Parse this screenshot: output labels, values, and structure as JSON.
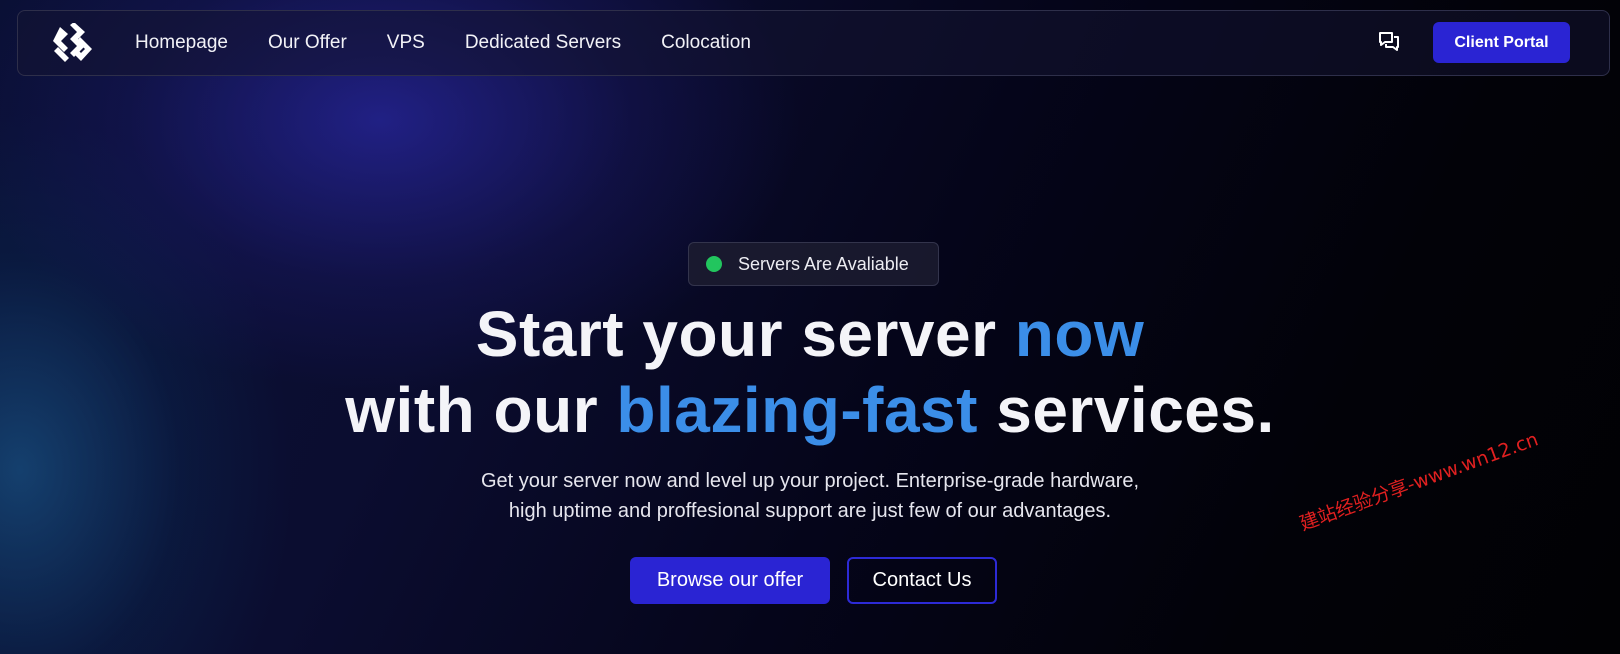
{
  "nav": {
    "logo_icon": "brand-logo-icon",
    "links": [
      {
        "label": "Homepage"
      },
      {
        "label": "Our Offer"
      },
      {
        "label": "VPS"
      },
      {
        "label": "Dedicated Servers"
      },
      {
        "label": "Colocation"
      }
    ],
    "chat_icon": "chat-bubbles-icon",
    "client_portal_label": "Client Portal"
  },
  "hero": {
    "status_text": "Servers Are Avaliable",
    "status_color": "#22c55e",
    "title_line1_a": "Start your server ",
    "title_line1_accent": "now",
    "title_line2_a": "with our ",
    "title_line2_accent": "blazing-fast",
    "title_line2_b": " services.",
    "subtitle_line1": "Get your server now and level up your project. Enterprise-grade hardware,",
    "subtitle_line2": "high uptime and proffesional support are just few of our advantages.",
    "primary_button": "Browse our offer",
    "secondary_button": "Contact Us"
  },
  "watermark": {
    "text": "建站经验分享-www.wn12.cn"
  },
  "colors": {
    "accent": "#3b8ee8",
    "button": "#2a24d3"
  }
}
